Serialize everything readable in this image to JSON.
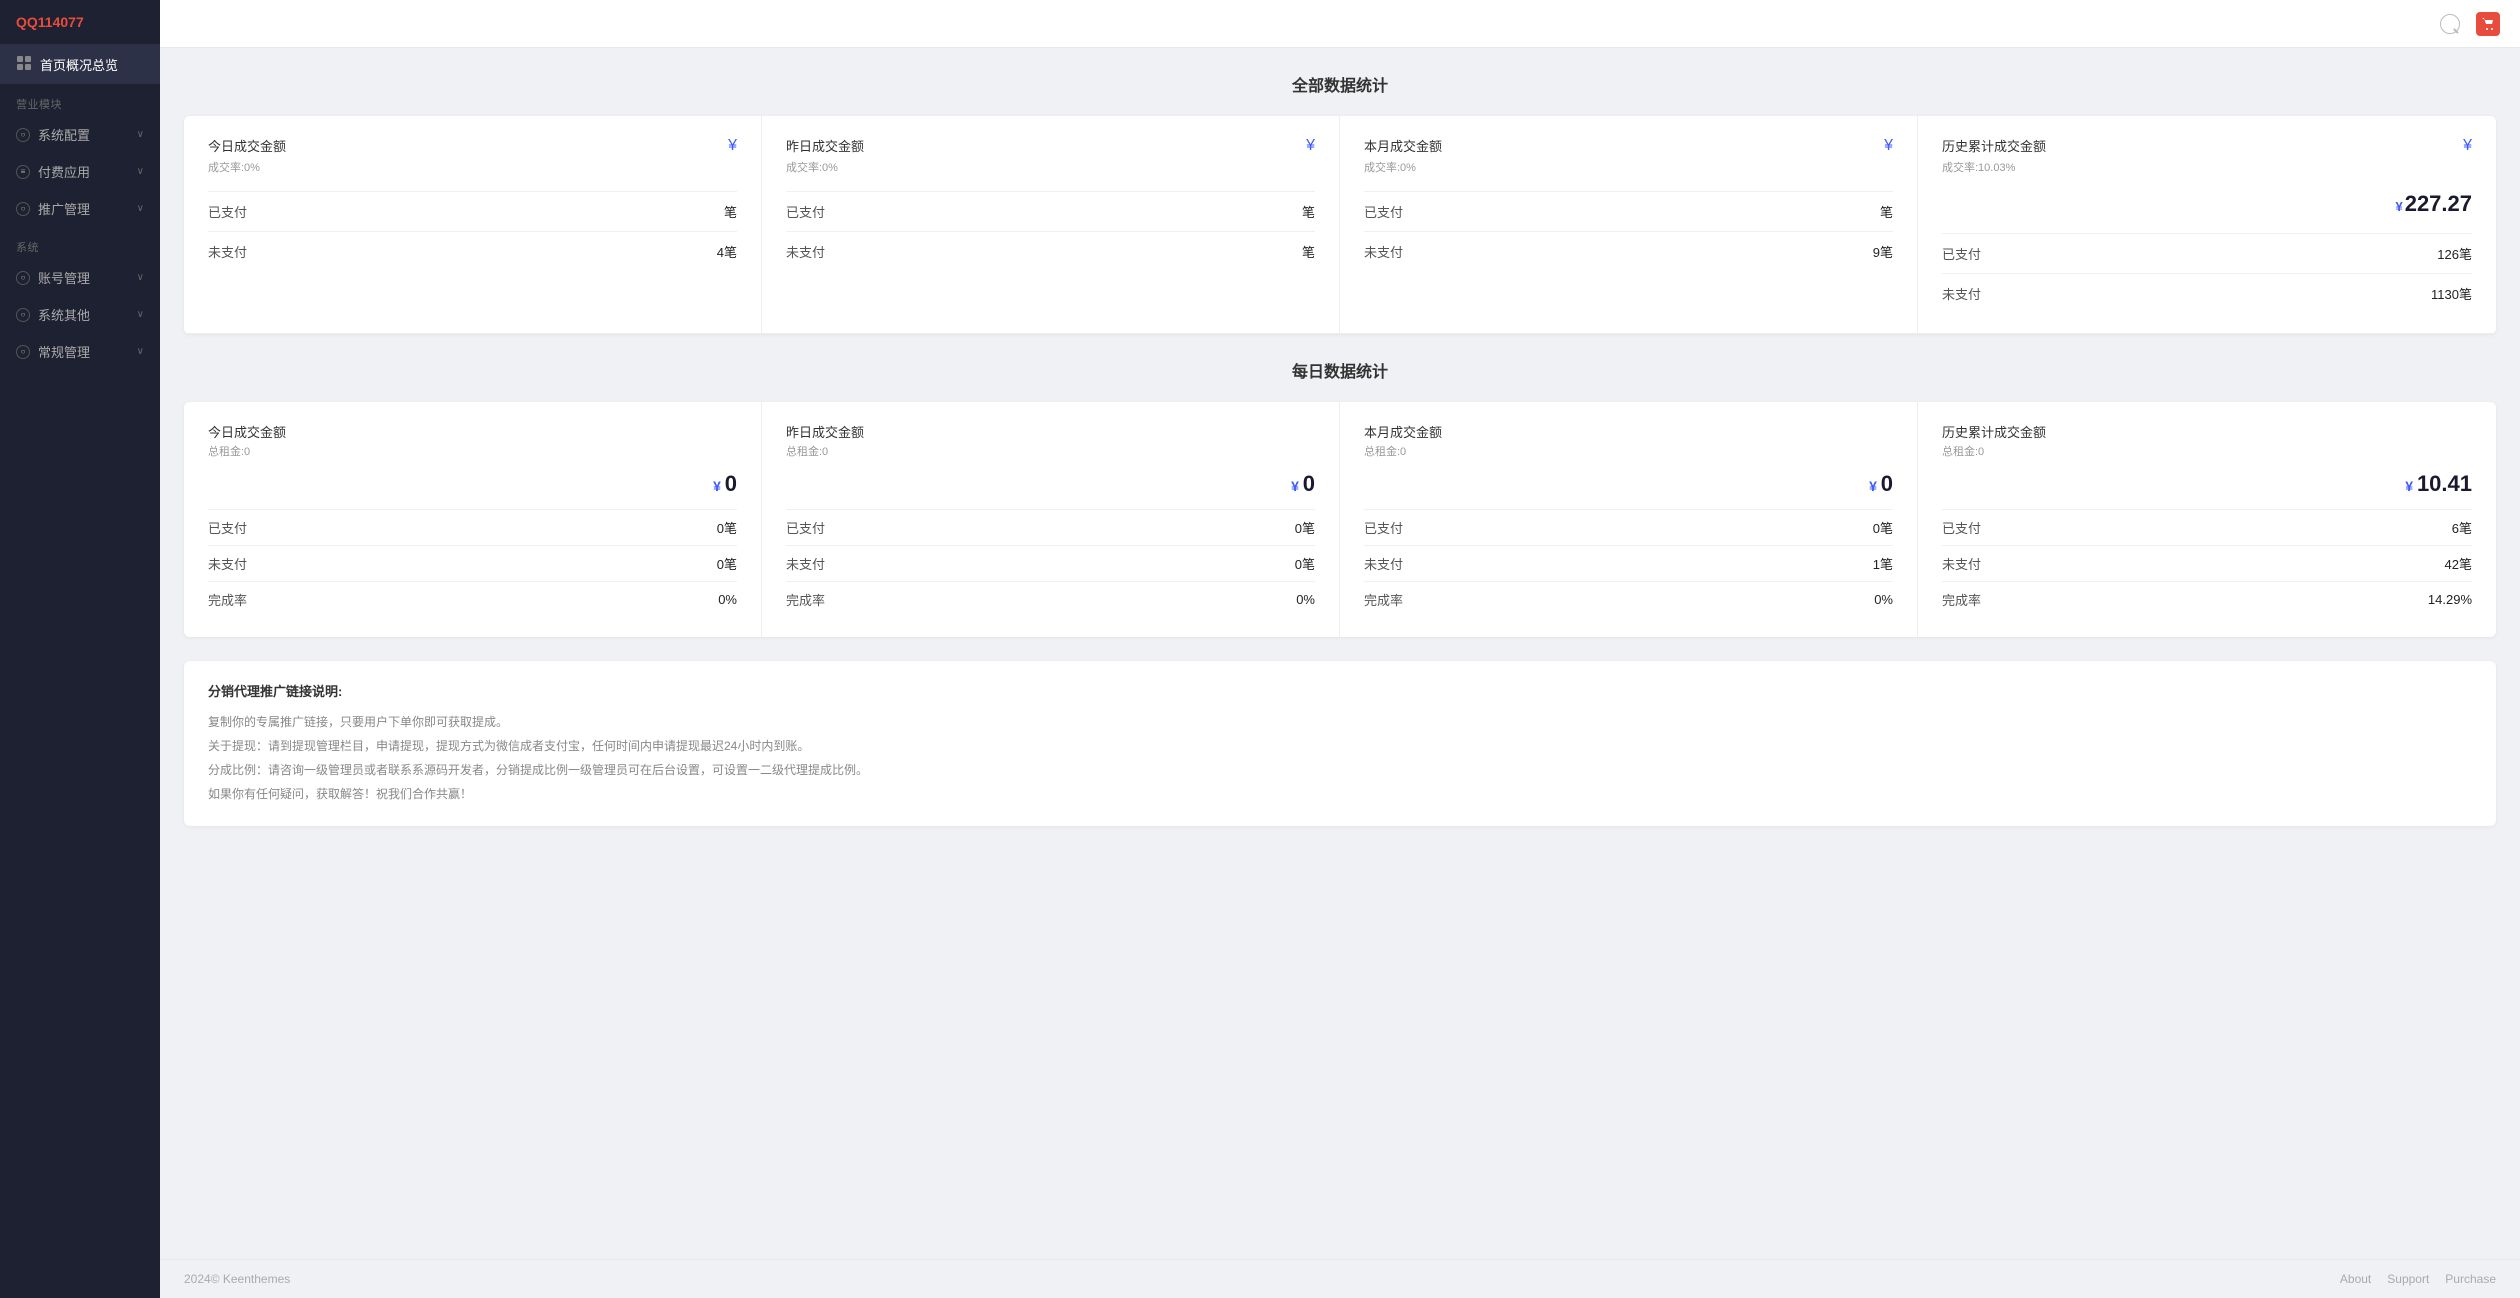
{
  "brand": {
    "title": "QQ114077",
    "toggle_icon": "←"
  },
  "sidebar": {
    "home_item": "首页概况总览",
    "sections": [
      {
        "label": "营业模块",
        "items": [
          {
            "id": "system-config",
            "label": "系统配置",
            "has_chevron": true
          },
          {
            "id": "payment-app",
            "label": "付费应用",
            "has_chevron": true
          },
          {
            "id": "promo-mgmt",
            "label": "推广管理",
            "has_chevron": true
          }
        ]
      },
      {
        "label": "系统",
        "items": [
          {
            "id": "account-mgmt",
            "label": "账号管理",
            "has_chevron": true
          },
          {
            "id": "sys-other",
            "label": "系统其他",
            "has_chevron": true
          },
          {
            "id": "routine-mgmt",
            "label": "常规管理",
            "has_chevron": true
          }
        ]
      }
    ]
  },
  "topbar": {
    "search_tooltip": "搜索",
    "cart_tooltip": "购物车"
  },
  "all_stats": {
    "section_title": "全部数据统计",
    "cards": [
      {
        "title": "今日成交金额",
        "subtitle": "成交率:0%",
        "yen_symbol": "¥",
        "value": "",
        "paid_label": "已支付",
        "paid_value": "笔",
        "unpaid_label": "未支付",
        "unpaid_value": "4笔"
      },
      {
        "title": "昨日成交金额",
        "subtitle": "成交率:0%",
        "yen_symbol": "¥",
        "value": "",
        "paid_label": "已支付",
        "paid_value": "笔",
        "unpaid_label": "未支付",
        "unpaid_value": "笔"
      },
      {
        "title": "本月成交金额",
        "subtitle": "成交率:0%",
        "yen_symbol": "¥",
        "value": "",
        "paid_label": "已支付",
        "paid_value": "笔",
        "unpaid_label": "未支付",
        "unpaid_value": "9笔"
      },
      {
        "title": "历史累计成交金额",
        "subtitle": "成交率:10.03%",
        "yen_symbol": "¥",
        "value": "227.27",
        "paid_label": "已支付",
        "paid_value": "126笔",
        "unpaid_label": "未支付",
        "unpaid_value": "1130笔"
      }
    ]
  },
  "daily_stats": {
    "section_title": "每日数据统计",
    "cards": [
      {
        "title": "今日成交金额",
        "subtitle": "总租金:0",
        "yen_symbol": "¥",
        "value": "0",
        "paid_label": "已支付",
        "paid_value": "0笔",
        "unpaid_label": "未支付",
        "unpaid_value": "0笔",
        "completion_label": "完成率",
        "completion_value": "0%"
      },
      {
        "title": "昨日成交金额",
        "subtitle": "总租金:0",
        "yen_symbol": "¥",
        "value": "0",
        "paid_label": "已支付",
        "paid_value": "0笔",
        "unpaid_label": "未支付",
        "unpaid_value": "0笔",
        "completion_label": "完成率",
        "completion_value": "0%"
      },
      {
        "title": "本月成交金额",
        "subtitle": "总租金:0",
        "yen_symbol": "¥",
        "value": "0",
        "paid_label": "已支付",
        "paid_value": "0笔",
        "unpaid_label": "未支付",
        "unpaid_value": "1笔",
        "completion_label": "完成率",
        "completion_value": "0%"
      },
      {
        "title": "历史累计成交金额",
        "subtitle": "总租金:0",
        "yen_symbol": "¥",
        "value": "10.41",
        "paid_label": "已支付",
        "paid_value": "6笔",
        "unpaid_label": "未支付",
        "unpaid_value": "42笔",
        "completion_label": "完成率",
        "completion_value": "14.29%"
      }
    ]
  },
  "description": {
    "title": "分销代理推广链接说明:",
    "lines": [
      "复制你的专属推广链接，只要用户下单你即可获取提成。",
      "关于提现：请到提现管理栏目，申请提现，提现方式为微信成者支付宝，任何时间内申请提现最迟24小时内到账。",
      "分成比例：请咨询一级管理员或者联系系源码开发者，分销提成比例一级管理员可在后台设置，可设置一二级代理提成比例。",
      "如果你有任何疑问，获取解答！祝我们合作共赢！"
    ]
  },
  "footer": {
    "copyright": "2024© Keenthemes",
    "links": [
      "About",
      "Support",
      "Purchase"
    ]
  }
}
